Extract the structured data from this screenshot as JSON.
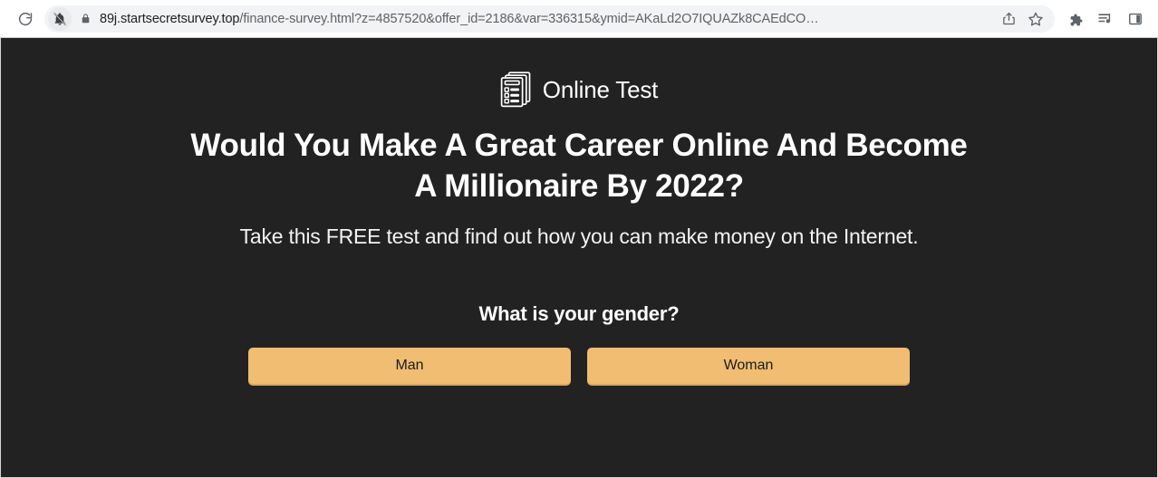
{
  "browser": {
    "reload_title": "Reload",
    "notifications_blocked_title": "Notifications blocked",
    "lock_title": "Connection is secure",
    "url_host": "89j.startsecretsurvey.top",
    "url_rest": "/finance-survey.html?z=4857520&offer_id=2186&var=336315&ymid=AKaLd2O7IQUAZk8CAEdCO…",
    "url_full": "89j.startsecretsurvey.top/finance-survey.html?z=4857520&offer_id=2186&var=336315&ymid=AKaLd2O7IQUAZk8CAEdCO…",
    "share_title": "Share this page",
    "bookmark_title": "Bookmark this tab",
    "extensions_title": "Extensions",
    "media_title": "Reading list",
    "side_panel_title": "Show side panel"
  },
  "page": {
    "brand_name": "Online Test",
    "headline_line1": "Would You Make A Great Career Online And Become",
    "headline_line2": "A Millionaire By 2022?",
    "subheadline": "Take this FREE test and find out how you can make money on the Internet.",
    "question": "What is your gender?",
    "answers": [
      {
        "label": "Man"
      },
      {
        "label": "Woman"
      }
    ],
    "colors": {
      "background": "#222222",
      "text": "#ffffff",
      "button_fill": "#f0bd72",
      "button_shadow": "#d9a760",
      "button_text": "#1c1c1c"
    }
  }
}
